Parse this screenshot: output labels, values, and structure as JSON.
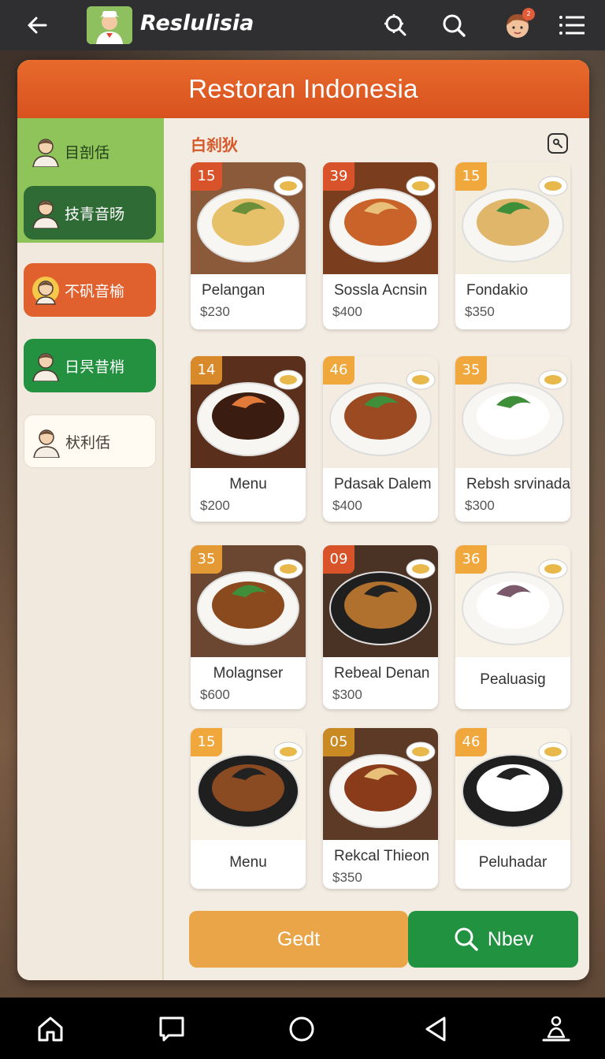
{
  "appbar": {
    "brand": "Reslulisia",
    "badge": "2"
  },
  "header": {
    "title": "Restoran Indonesia"
  },
  "sidebar": {
    "items": [
      {
        "label": "目剖佸"
      },
      {
        "label": "技青音旸"
      },
      {
        "label": "不矾音榆"
      },
      {
        "label": "日昗昔梢"
      },
      {
        "label": "枤利佸"
      }
    ]
  },
  "main": {
    "section_title": "白刹狄",
    "menu": [
      {
        "badge": "15",
        "name": "Pelangan",
        "price": "$230"
      },
      {
        "badge": "39",
        "name": "Sossla Acnsin",
        "price": "$400"
      },
      {
        "badge": "15",
        "name": "Fondakio",
        "price": "$350"
      },
      {
        "badge": "14",
        "name": "Menu",
        "price": "$200"
      },
      {
        "badge": "46",
        "name": "Pdasak Dalem",
        "price": "$400"
      },
      {
        "badge": "35",
        "name": "Rebsh srvinadar",
        "price": "$300"
      },
      {
        "badge": "35",
        "name": "Molagnser",
        "price": "$600"
      },
      {
        "badge": "09",
        "name": "Rebeal Denan",
        "price": "$300"
      },
      {
        "badge": "36",
        "name": "Pealuasig",
        "price": ""
      },
      {
        "badge": "15",
        "name": "Menu",
        "price": ""
      },
      {
        "badge": "05",
        "name": "Rekcal Thieon",
        "price": "$350"
      },
      {
        "badge": "46",
        "name": "Peluhadar",
        "price": ""
      }
    ]
  },
  "buttons": {
    "primary": "Gedt",
    "search": "Nbev"
  },
  "colors": {
    "header": "#e0612d",
    "green": "#21923f",
    "orange": "#eaa549"
  }
}
